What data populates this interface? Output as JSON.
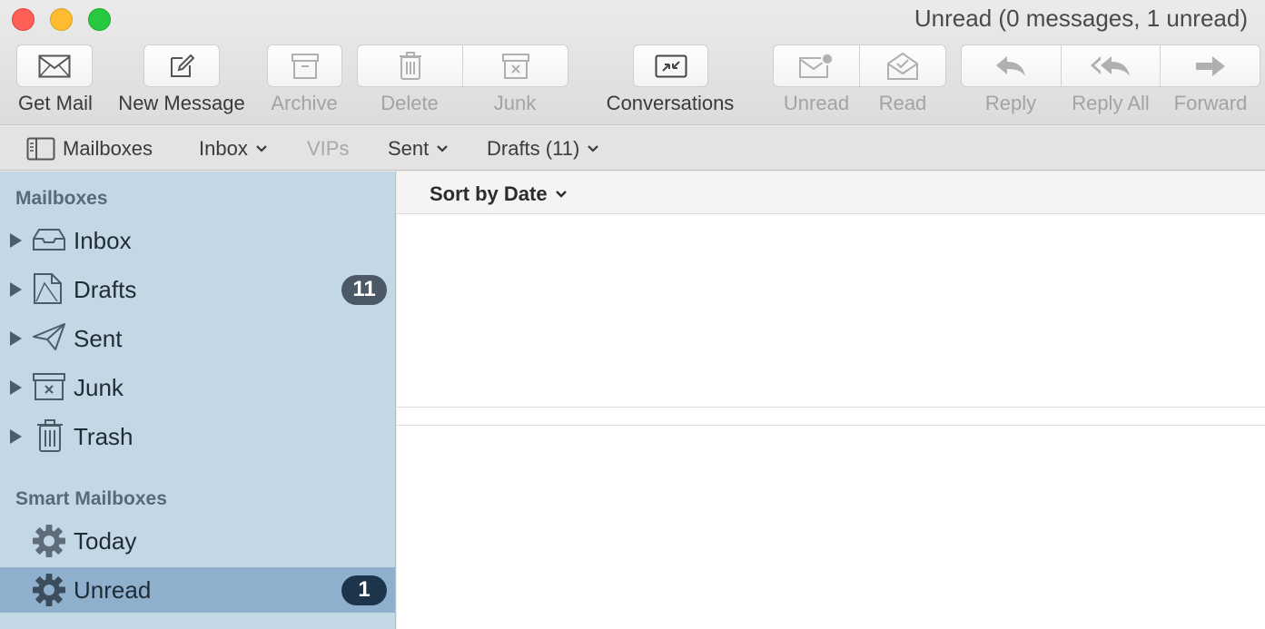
{
  "window": {
    "title": "Unread (0 messages, 1 unread)"
  },
  "toolbar": {
    "get_mail": "Get Mail",
    "new_message": "New Message",
    "archive": "Archive",
    "delete": "Delete",
    "junk": "Junk",
    "conversations": "Conversations",
    "unread": "Unread",
    "read": "Read",
    "reply": "Reply",
    "reply_all": "Reply All",
    "forward": "Forward"
  },
  "favorites": {
    "mailboxes": "Mailboxes",
    "inbox": "Inbox",
    "vips": "VIPs",
    "sent": "Sent",
    "drafts": "Drafts (11)"
  },
  "sidebar": {
    "mailboxes_header": "Mailboxes",
    "items": [
      {
        "label": "Inbox",
        "icon": "inbox-icon"
      },
      {
        "label": "Drafts",
        "icon": "drafts-icon",
        "badge": "11"
      },
      {
        "label": "Sent",
        "icon": "paper-plane-icon"
      },
      {
        "label": "Junk",
        "icon": "junk-icon"
      },
      {
        "label": "Trash",
        "icon": "trash-icon"
      }
    ],
    "smart_header": "Smart Mailboxes",
    "smart_items": [
      {
        "label": "Today",
        "icon": "gear-icon"
      },
      {
        "label": "Unread",
        "icon": "gear-icon",
        "badge": "1",
        "selected": true
      }
    ]
  },
  "list": {
    "sort_label": "Sort by Date"
  },
  "colors": {
    "sidebar_bg": "#c4d7e5",
    "sidebar_selected": "#8fb0cd",
    "badge": "#4b5966",
    "badge_selected": "#1d354c"
  }
}
